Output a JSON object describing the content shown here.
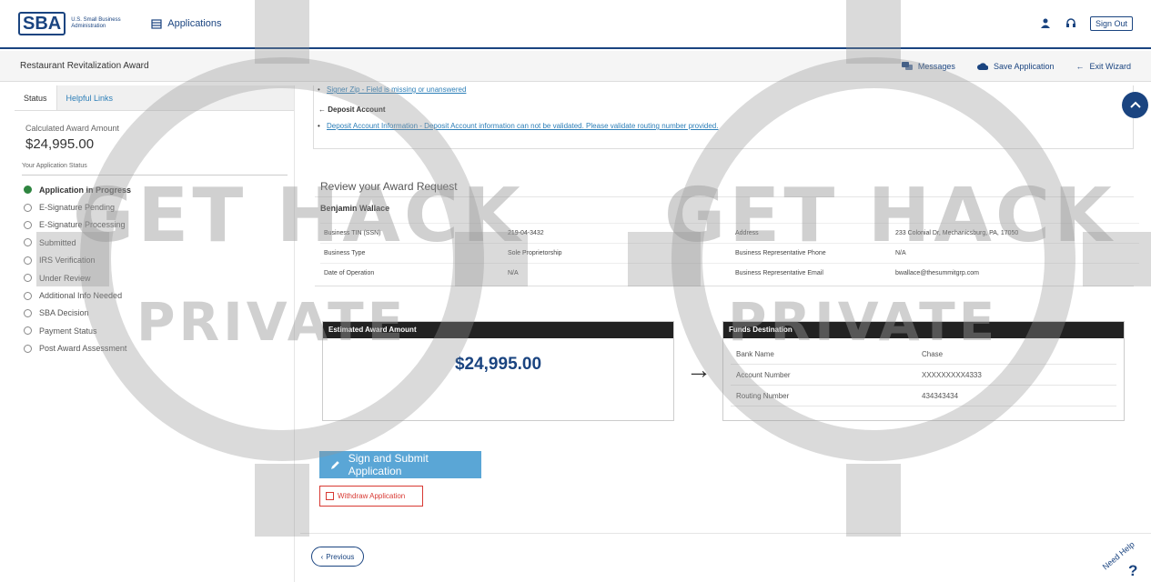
{
  "header": {
    "logo_mark": "SBA",
    "logo_text": "U.S. Small Business Administration",
    "apps_label": "Applications",
    "signout_label": "Sign Out"
  },
  "subheader": {
    "title": "Restaurant Revitalization Award",
    "messages": "Messages",
    "save": "Save Application",
    "exit": "Exit Wizard"
  },
  "sidebar": {
    "tabs": [
      "Status",
      "Helpful Links"
    ],
    "calc_label": "Calculated Award Amount",
    "calc_value": "$24,995.00",
    "status_heading": "Your Application Status",
    "statuses": [
      "Application in Progress",
      "E-Signature Pending",
      "E-Signature Processing",
      "Submitted",
      "IRS Verification",
      "Under Review",
      "Additional Info Needed",
      "SBA Decision",
      "Payment Status",
      "Post Award Assessment"
    ]
  },
  "errors": {
    "item1": "Signer Zip - Field is missing or unanswered",
    "section": "Deposit Account",
    "item2": "Deposit Account Information - Deposit Account information can not be validated. Please validate routing number provided."
  },
  "review": {
    "title": "Review your Award Request",
    "name": "Benjamin Wallace",
    "rows": [
      {
        "l1": "Business TIN (SSN)",
        "v1": "219-04-3432",
        "l2": "Address",
        "v2": "233 Colonial Dr, Mechanicsburg, PA, 17050"
      },
      {
        "l1": "Business Type",
        "v1": "Sole Proprietorship",
        "l2": "Business Representative Phone",
        "v2": "N/A"
      },
      {
        "l1": "Date of Operation",
        "v1": "N/A",
        "l2": "Business Representative Email",
        "v2": "bwallace@thesummitgrp.com"
      }
    ]
  },
  "estimate": {
    "heading": "Estimated Award Amount",
    "amount": "$24,995.00"
  },
  "funds": {
    "heading": "Funds Destination",
    "rows": [
      {
        "label": "Bank Name",
        "value": "Chase"
      },
      {
        "label": "Account Number",
        "value": "XXXXXXXXX4333"
      },
      {
        "label": "Routing Number",
        "value": "434343434"
      }
    ]
  },
  "actions": {
    "sign": "Sign and Submit Application",
    "withdraw": "Withdraw Application",
    "previous": "Previous"
  },
  "help": {
    "label": "Need Help",
    "q": "?"
  },
  "watermark": {
    "line1": "GET HACK",
    "line2": "PRIVATE"
  }
}
